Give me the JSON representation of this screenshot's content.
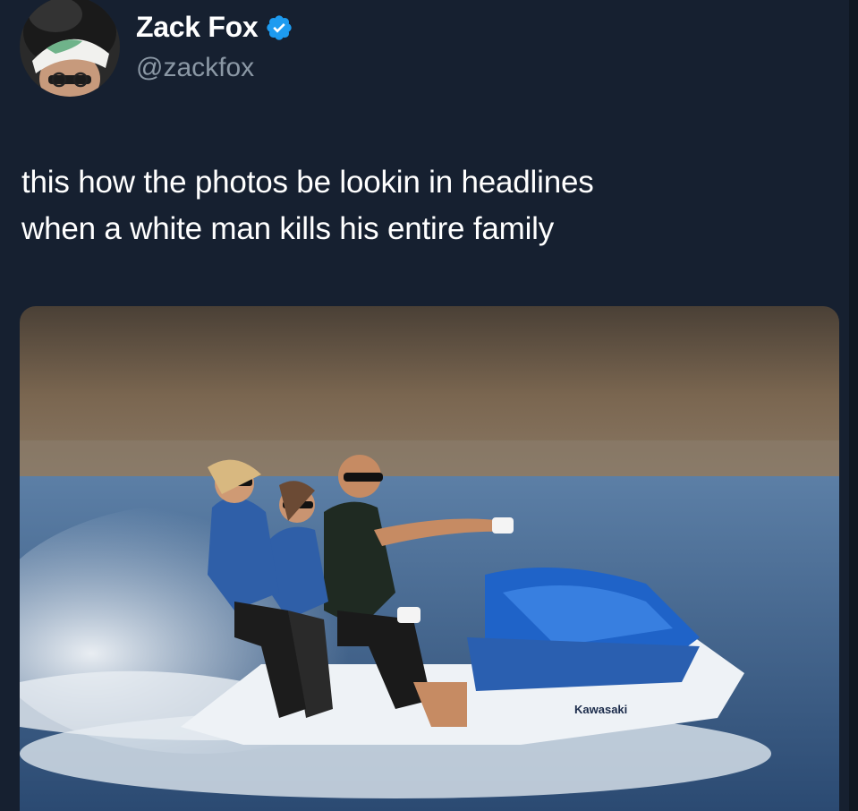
{
  "tweet": {
    "author": {
      "display_name": "Zack Fox",
      "handle": "@zackfox",
      "verified": true,
      "avatar_icon": "profile-photo-icon"
    },
    "text": "this how the photos be lookin in headlines\nwhen a white man kills his entire family",
    "media": {
      "type": "photo",
      "brand_text": "Kawasaki"
    }
  },
  "colors": {
    "background": "#162030",
    "text": "#ffffff",
    "secondary_text": "#8b98a5",
    "verified_badge": "#1d9bf0"
  }
}
